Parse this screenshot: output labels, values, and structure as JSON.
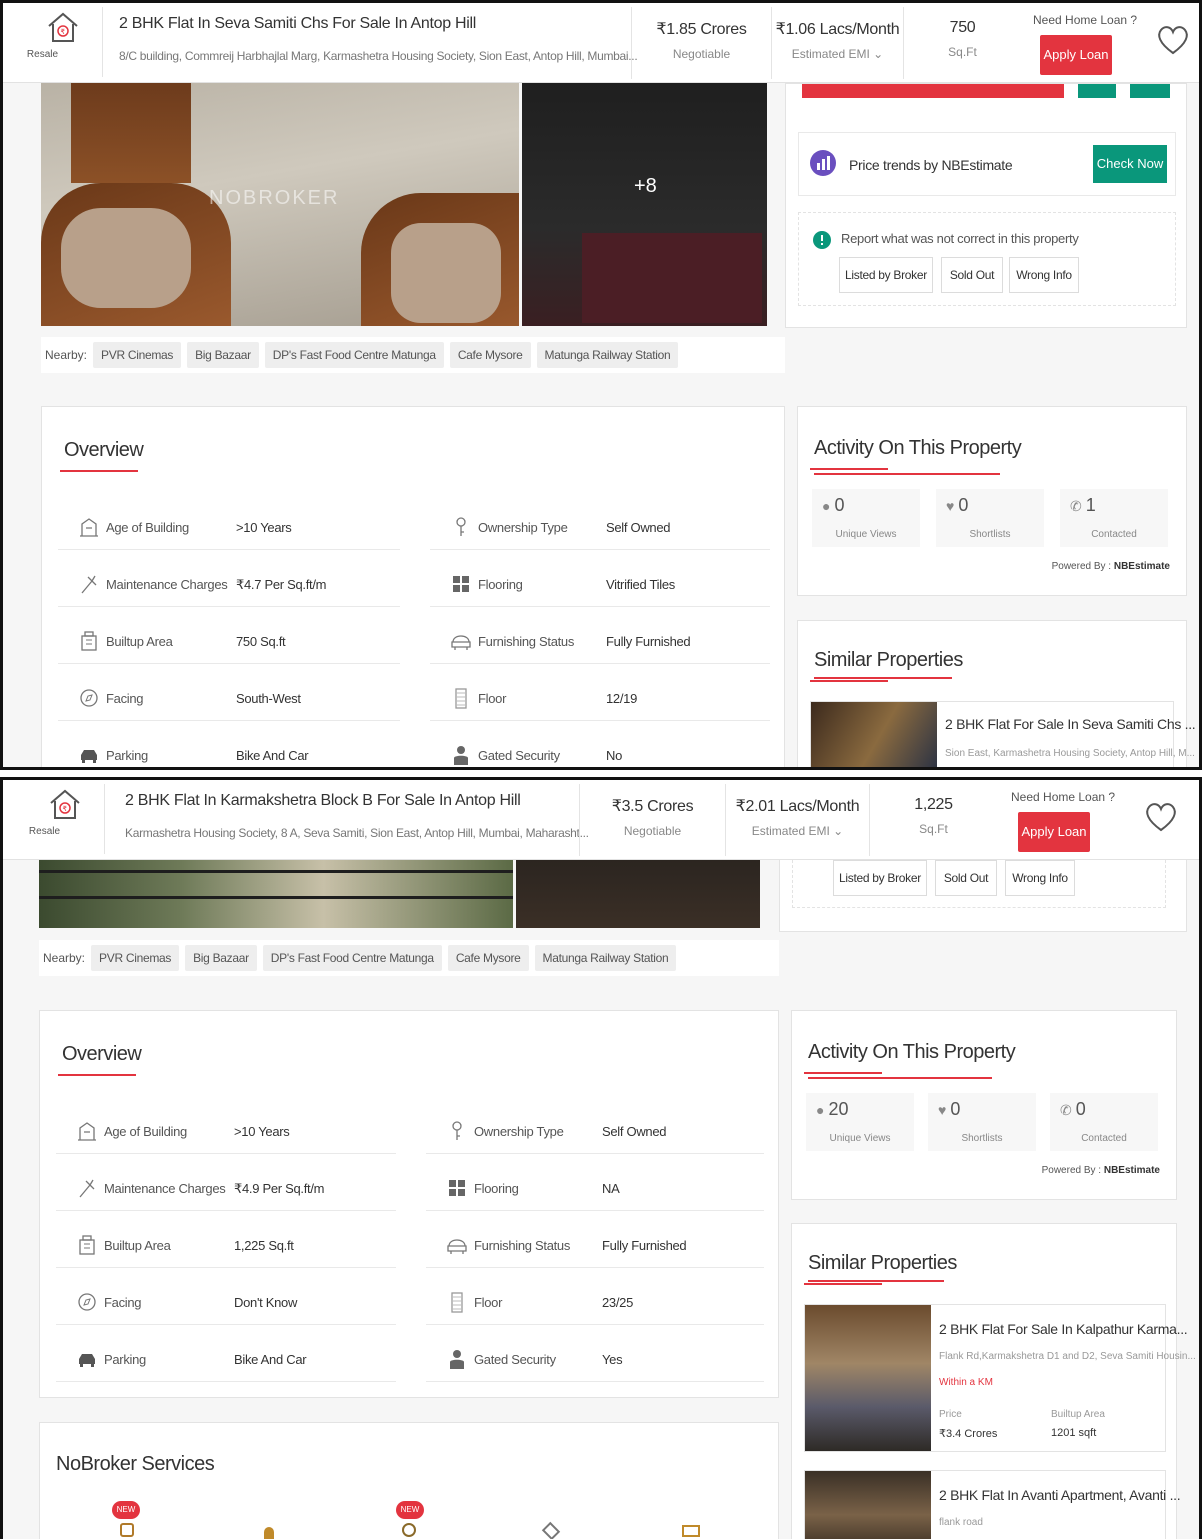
{
  "screen1": {
    "header": {
      "resale_label": "Resale",
      "title": "2 BHK Flat In Seva Samiti Chs For Sale In Antop Hill",
      "address": "8/C building, Commreij Harbhajlal Marg, Karmashetra Housing Society, Sion East, Antop Hill, Mumbai...",
      "price": "₹1.85 Crores",
      "price_note": "Negotiable",
      "emi": "₹1.06 Lacs/Month",
      "emi_note": "Estimated EMI ⌄",
      "area": "750",
      "area_unit": "Sq.Ft",
      "loan_question": "Need Home Loan ?",
      "loan_button": "Apply Loan"
    },
    "photos": {
      "more_count": "+8",
      "watermark": "NOBROKER"
    },
    "nearby": {
      "label": "Nearby:",
      "places": [
        "PVR Cinemas",
        "Big Bazaar",
        "DP's Fast Food Centre Matunga",
        "Cafe Mysore",
        "Matunga Railway Station"
      ]
    },
    "price_trends": {
      "text": "Price trends by NBEstimate",
      "button": "Check Now"
    },
    "report": {
      "text": "Report what was not correct in this property",
      "options": [
        "Listed by Broker",
        "Sold Out",
        "Wrong Info"
      ]
    },
    "overview": {
      "title": "Overview",
      "rows": [
        {
          "label": "Age of Building",
          "value": ">10 Years",
          "label2": "Ownership Type",
          "value2": "Self Owned"
        },
        {
          "label": "Maintenance Charges",
          "value": "₹4.7 Per Sq.ft/m",
          "label2": "Flooring",
          "value2": "Vitrified Tiles"
        },
        {
          "label": "Builtup Area",
          "value": "750 Sq.ft",
          "label2": "Furnishing Status",
          "value2": "Fully Furnished"
        },
        {
          "label": "Facing",
          "value": "South-West",
          "label2": "Floor",
          "value2": "12/19"
        },
        {
          "label": "Parking",
          "value": "Bike And Car",
          "label2": "Gated Security",
          "value2": "No"
        }
      ]
    },
    "activity": {
      "title": "Activity On This Property",
      "stats": [
        {
          "count": "0",
          "label": "Unique Views"
        },
        {
          "count": "0",
          "label": "Shortlists"
        },
        {
          "count": "1",
          "label": "Contacted"
        }
      ],
      "powered_label": "Powered By :",
      "powered_brand": "NBEstimate"
    },
    "similar": {
      "title": "Similar Properties",
      "items": [
        {
          "title": "2 BHK Flat For Sale In Seva Samiti Chs ...",
          "address": "Sion East, Karmashetra Housing Society, Antop Hill, M..."
        }
      ]
    }
  },
  "screen2": {
    "header": {
      "resale_label": "Resale",
      "title": "2 BHK Flat In Karmakshetra Block B For Sale In Antop Hill",
      "address": "Karmashetra Housing Society, 8 A, Seva Samiti, Sion East, Antop Hill, Mumbai, Maharasht...",
      "price": "₹3.5 Crores",
      "price_note": "Negotiable",
      "emi": "₹2.01 Lacs/Month",
      "emi_note": "Estimated EMI ⌄",
      "area": "1,225",
      "area_unit": "Sq.Ft",
      "loan_question": "Need Home Loan ?",
      "loan_button": "Apply Loan"
    },
    "report": {
      "options": [
        "Listed by Broker",
        "Sold Out",
        "Wrong Info"
      ]
    },
    "nearby": {
      "label": "Nearby:",
      "places": [
        "PVR Cinemas",
        "Big Bazaar",
        "DP's Fast Food Centre Matunga",
        "Cafe Mysore",
        "Matunga Railway Station"
      ]
    },
    "overview": {
      "title": "Overview",
      "rows": [
        {
          "label": "Age of Building",
          "value": ">10 Years",
          "label2": "Ownership Type",
          "value2": "Self Owned"
        },
        {
          "label": "Maintenance Charges",
          "value": "₹4.9 Per Sq.ft/m",
          "label2": "Flooring",
          "value2": "NA"
        },
        {
          "label": "Builtup Area",
          "value": "1,225 Sq.ft",
          "label2": "Furnishing Status",
          "value2": "Fully Furnished"
        },
        {
          "label": "Facing",
          "value": "Don't Know",
          "label2": "Floor",
          "value2": "23/25"
        },
        {
          "label": "Parking",
          "value": "Bike And Car",
          "label2": "Gated Security",
          "value2": "Yes"
        }
      ]
    },
    "activity": {
      "title": "Activity On This Property",
      "stats": [
        {
          "count": "20",
          "label": "Unique Views"
        },
        {
          "count": "0",
          "label": "Shortlists"
        },
        {
          "count": "0",
          "label": "Contacted"
        }
      ],
      "powered_label": "Powered By :",
      "powered_brand": "NBEstimate"
    },
    "similar": {
      "title": "Similar Properties",
      "items": [
        {
          "title": "2 BHK Flat For Sale In Kalpathur Karma...",
          "address": "Flank Rd,Karmakshetra D1 and D2, Seva Samiti Housin...",
          "distance": "Within a KM",
          "price_label": "Price",
          "price": "₹3.4 Crores",
          "area_label": "Builtup Area",
          "area": "1201 sqft"
        },
        {
          "title": "2 BHK Flat In Avanti Apartment, Avanti ...",
          "address": "flank road"
        }
      ]
    },
    "services": {
      "title": "NoBroker Services",
      "new_badge": "NEW"
    }
  },
  "colors": {
    "accent": "#e3343f",
    "green": "#0a977b",
    "purple": "#6a4fbf"
  },
  "icons": [
    "home-icon",
    "heart-icon",
    "chevron-down-icon",
    "info-icon",
    "chart-icon",
    "building-icon",
    "key-icon",
    "tiles-icon",
    "sofa-icon",
    "compass-icon",
    "elevator-icon",
    "car-icon",
    "guard-icon",
    "person-icon",
    "phone-icon"
  ]
}
